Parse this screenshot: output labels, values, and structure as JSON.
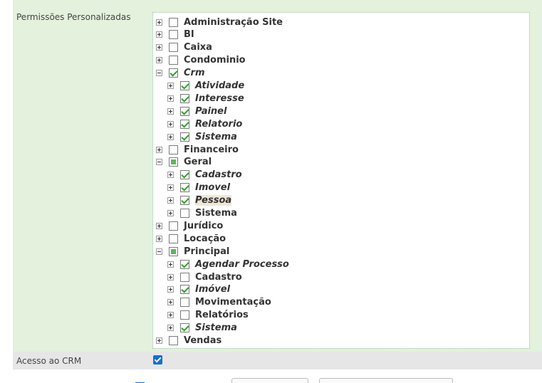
{
  "permissions": {
    "label": "Permissões Personalizadas",
    "tree": [
      {
        "label": "Administração Site",
        "expander": "plus",
        "check": "unchecked"
      },
      {
        "label": "BI",
        "expander": "plus",
        "check": "unchecked"
      },
      {
        "label": "Caixa",
        "expander": "plus",
        "check": "unchecked"
      },
      {
        "label": "Condominio",
        "expander": "plus",
        "check": "unchecked"
      },
      {
        "label": "Crm",
        "expander": "minus",
        "check": "checked",
        "italic": true
      },
      {
        "label": "Atividade",
        "expander": "plus",
        "check": "checked",
        "italic": true,
        "level": 1
      },
      {
        "label": "Interesse",
        "expander": "plus",
        "check": "checked",
        "italic": true,
        "level": 1
      },
      {
        "label": "Painel",
        "expander": "plus",
        "check": "checked",
        "italic": true,
        "level": 1
      },
      {
        "label": "Relatorio",
        "expander": "plus",
        "check": "checked",
        "italic": true,
        "level": 1
      },
      {
        "label": "Sistema",
        "expander": "plus",
        "check": "checked",
        "italic": true,
        "level": 1
      },
      {
        "label": "Financeiro",
        "expander": "plus",
        "check": "unchecked"
      },
      {
        "label": "Geral",
        "expander": "minus",
        "check": "partial"
      },
      {
        "label": "Cadastro",
        "expander": "plus",
        "check": "checked",
        "italic": true,
        "level": 1
      },
      {
        "label": "Imovel",
        "expander": "plus",
        "check": "checked",
        "italic": true,
        "level": 1
      },
      {
        "label": "Pessoa",
        "expander": "plus",
        "check": "checked",
        "italic": true,
        "level": 1,
        "highlight": true
      },
      {
        "label": "Sistema",
        "expander": "plus",
        "check": "unchecked",
        "level": 1
      },
      {
        "label": "Jurídico",
        "expander": "plus",
        "check": "unchecked"
      },
      {
        "label": "Locação",
        "expander": "plus",
        "check": "unchecked"
      },
      {
        "label": "Principal",
        "expander": "minus",
        "check": "partial"
      },
      {
        "label": "Agendar Processo",
        "expander": "plus",
        "check": "checked",
        "italic": true,
        "level": 1
      },
      {
        "label": "Cadastro",
        "expander": "plus",
        "check": "unchecked",
        "level": 1
      },
      {
        "label": "Imóvel",
        "expander": "plus",
        "check": "checked",
        "italic": true,
        "level": 1
      },
      {
        "label": "Movimentação",
        "expander": "plus",
        "check": "unchecked",
        "level": 1
      },
      {
        "label": "Relatórios",
        "expander": "plus",
        "check": "unchecked",
        "level": 1
      },
      {
        "label": "Sistema",
        "expander": "plus",
        "check": "checked",
        "italic": true,
        "level": 1
      },
      {
        "label": "Vendas",
        "expander": "plus",
        "check": "unchecked"
      }
    ]
  },
  "crm_access": {
    "label": "Acesso ao CRM",
    "checked": true
  },
  "colors": {
    "row_background": "#e3f1dd",
    "check_accent": "#2e9e2e",
    "partial_fill": "#5cb85c",
    "crm_checkbox": "#0f6fd8"
  }
}
